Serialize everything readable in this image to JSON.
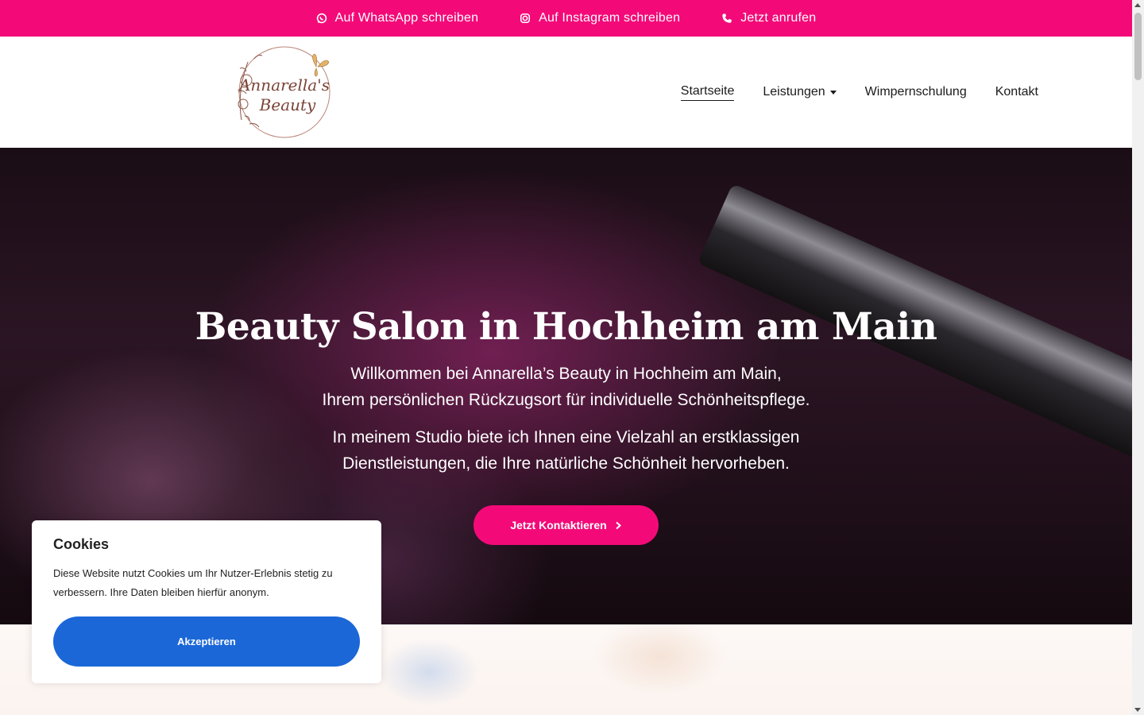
{
  "topbar": {
    "whatsapp": "Auf WhatsApp schreiben",
    "instagram": "Auf Instagram schreiben",
    "phone": "Jetzt anrufen"
  },
  "logo": {
    "line1": "Annarella's",
    "line2": "Beauty"
  },
  "nav": {
    "home": "Startseite",
    "services": "Leistungen",
    "training": "Wimpernschulung",
    "contact": "Kontakt"
  },
  "hero": {
    "title": "Beauty Salon in Hochheim am Main",
    "p1_line1": "Willkommen bei Annarella’s Beauty in Hochheim am Main,",
    "p1_line2": "Ihrem persönlichen Rückzugsort für individuelle Schönheitspflege.",
    "p2_line1": "In meinem Studio biete ich Ihnen eine Vielzahl an erstklassigen",
    "p2_line2": "Dienstleistungen, die Ihre natürliche Schönheit hervorheben.",
    "cta": "Jetzt Kontaktieren"
  },
  "cookie": {
    "title": "Cookies",
    "text": "Diese Website nutzt Cookies um Ihr Nutzer-Erlebnis stetig zu verbessern. Ihre Daten bleiben hierfür anonym.",
    "accept": "Akzeptieren"
  },
  "colors": {
    "accent": "#f30a78",
    "button_blue": "#1b67d8"
  }
}
